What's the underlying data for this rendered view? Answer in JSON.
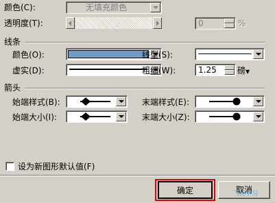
{
  "fill": {
    "color_label": "颜色(C):",
    "color_value": "无填充颜色",
    "transparency_label": "透明度(T):",
    "transparency_value": "0",
    "transparency_unit": "%"
  },
  "line": {
    "section_label": "线条",
    "color_label": "颜色(O):",
    "color_swatch": "#6f9ac4",
    "style_label": "线型(S):",
    "dash_label": "虚实(D):",
    "weight_label": "粗细(W):",
    "weight_value": "1.25",
    "weight_unit": "磅"
  },
  "arrows": {
    "section_label": "箭头",
    "begin_style_label": "始端样式(B):",
    "end_style_label": "末端样式(E):",
    "begin_size_label": "始端大小(I):",
    "end_size_label": "末端大小(Z):"
  },
  "default_checkbox_label": "设为新图形默认值(F)",
  "buttons": {
    "ok": "确定",
    "cancel": "取消"
  },
  "watermark": "飞特学习",
  "highlight_color": "#e00000"
}
